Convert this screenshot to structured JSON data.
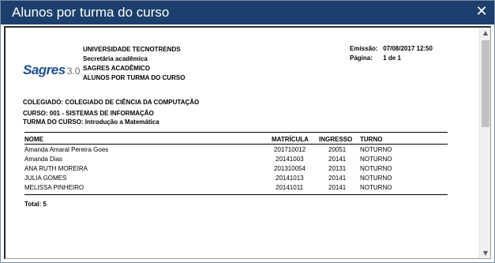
{
  "window": {
    "title": "Alunos por turma do curso",
    "close_glyph": "✕"
  },
  "logo": {
    "name": "Sagres",
    "version": "3.0"
  },
  "header": {
    "university": "UNIVERSIDADE TECNOTRENDS",
    "department": "Secretária acadêmica",
    "system": "SAGRES ACADÊMICO",
    "report": "ALUNOS POR TURMA DO CURSO"
  },
  "info": {
    "emissao_label": "Emissão:",
    "emissao_value": "07/08/2017 12:50",
    "pagina_label": "Página:",
    "pagina_value": "1 de 1"
  },
  "details": {
    "colegiado": "COLEGIADO: COLEGIADO DE CIÊNCIA DA COMPUTAÇÃO",
    "curso": "CURSO: 001 - SISTEMAS DE INFORMAÇÃO",
    "turma": "TURMA DO CURSO: Introdução a Matemática"
  },
  "table": {
    "headers": {
      "nome": "NOME",
      "matricula": "MATRÍCULA",
      "ingresso": "INGRESSO",
      "turno": "TURNO"
    },
    "rows": [
      {
        "nome": "Amanda  Amaral Pereira Goes",
        "matricula": "201710012",
        "ingresso": "20051",
        "turno": "NOTURNO"
      },
      {
        "nome": "Amanda Dias",
        "matricula": "20141003",
        "ingresso": "20141",
        "turno": "NOTURNO"
      },
      {
        "nome": "ANA RUTH MOREIRA",
        "matricula": "201310054",
        "ingresso": "20131",
        "turno": "NOTURNO"
      },
      {
        "nome": "JULIA GOMES",
        "matricula": "20141013",
        "ingresso": "20141",
        "turno": "NOTURNO"
      },
      {
        "nome": "MELISSA PINHEIRO",
        "matricula": "20141011",
        "ingresso": "20141",
        "turno": "NOTURNO"
      }
    ],
    "total": "Total: 5"
  },
  "scrollbar": {
    "up_glyph": "▲",
    "down_glyph": "▼"
  }
}
